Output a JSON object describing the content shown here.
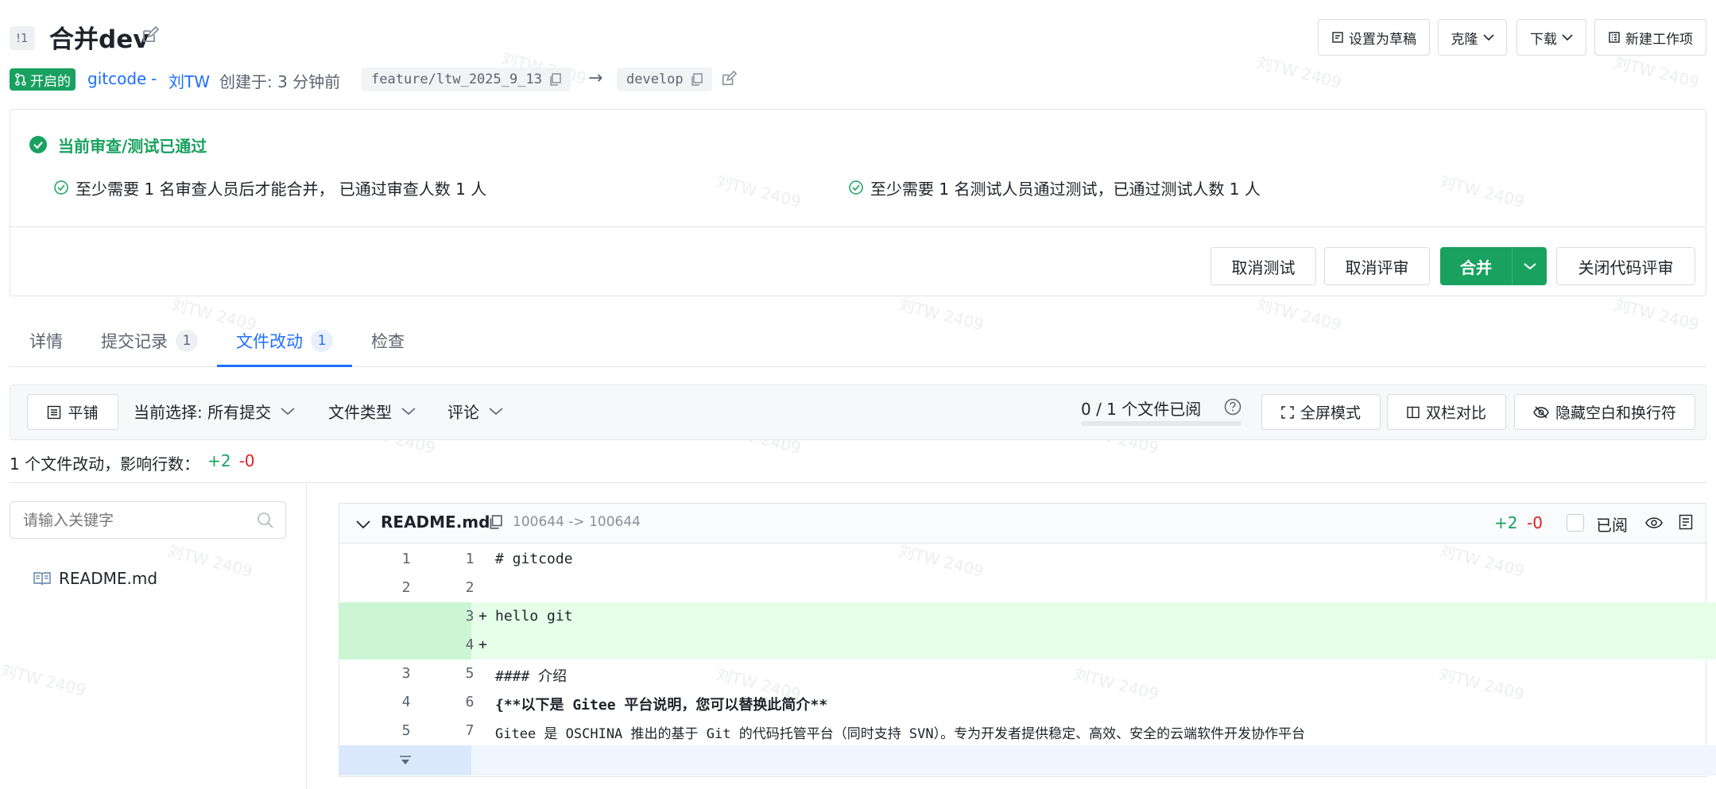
{
  "header": {
    "mr_id": "!1",
    "title": "合并dev",
    "status": "开启的",
    "repo": "gitcode",
    "separator": "-",
    "author": "刘TW",
    "created": "创建于: 3 分钟前",
    "source_branch": "feature/ltw_2025_9_13",
    "arrow": "→",
    "target_branch": "develop",
    "actions": {
      "draft": "设置为草稿",
      "clone": "克隆",
      "download": "下载",
      "new_work_item": "新建工作项"
    }
  },
  "review": {
    "title": "当前审查/测试已通过",
    "check_review": "至少需要 1 名审查人员后才能合并， 已通过审查人数 1 人",
    "check_test": "至少需要 1 名测试人员通过测试，已通过测试人数 1 人",
    "buttons": {
      "cancel_test": "取消测试",
      "cancel_review": "取消评审",
      "merge": "合并",
      "close_review": "关闭代码评审"
    }
  },
  "tabs": [
    {
      "label": "详情",
      "count": ""
    },
    {
      "label": "提交记录",
      "count": "1"
    },
    {
      "label": "文件改动",
      "count": "1"
    },
    {
      "label": "检查",
      "count": ""
    }
  ],
  "toolbar": {
    "flat": "平铺",
    "selection": "当前选择: 所有提交",
    "file_type": "文件类型",
    "comments": "评论",
    "viewed": "0 / 1 个文件已阅",
    "viewed_progress": 0,
    "fullscreen": "全屏模式",
    "split": "双栏对比",
    "hide_whitespace": "隐藏空白和换行符"
  },
  "summary": {
    "text": "1 个文件改动，影响行数：",
    "added": "+2",
    "removed": "-0"
  },
  "sidebar": {
    "search_placeholder": "请输入关键字",
    "files": [
      "README.md"
    ]
  },
  "diff": {
    "filename": "README.md",
    "mode": "100644 -> 100644",
    "added": "+2",
    "removed": "-0",
    "viewed_label": "已阅",
    "lines": [
      {
        "old": "1",
        "new": "1",
        "sign": " ",
        "text": "# gitcode",
        "type": "context"
      },
      {
        "old": "2",
        "new": "2",
        "sign": " ",
        "text": "",
        "type": "context"
      },
      {
        "old": "",
        "new": "3",
        "sign": "+",
        "text": "hello git",
        "type": "added"
      },
      {
        "old": "",
        "new": "4",
        "sign": "+",
        "text": "",
        "type": "added"
      },
      {
        "old": "3",
        "new": "5",
        "sign": " ",
        "text": "#### 介绍",
        "type": "context"
      },
      {
        "old": "4",
        "new": "6",
        "sign": " ",
        "text": "{**以下是 Gitee 平台说明，您可以替换此简介**",
        "type": "context"
      },
      {
        "old": "5",
        "new": "7",
        "sign": " ",
        "text": "Gitee 是 OSCHINA 推出的基于 Git 的代码托管平台（同时支持 SVN）。专为开发者提供稳定、高效、安全的云端软件开发协作平台",
        "type": "context"
      }
    ]
  },
  "watermark": "刘TW 2409",
  "colors": {
    "accent": "#1e6fff",
    "success": "#19a15f",
    "added_bg": "#e6ffe9",
    "added_gutter": "#ccf5d3",
    "danger": "#e02020"
  }
}
